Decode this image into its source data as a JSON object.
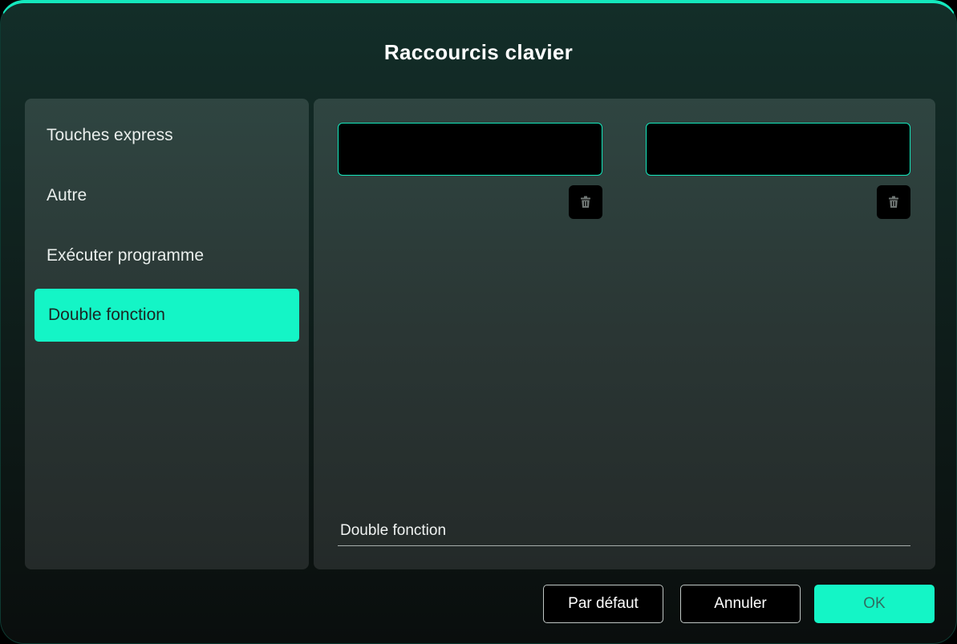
{
  "dialog": {
    "title": "Raccourcis clavier"
  },
  "sidebar": {
    "items": [
      {
        "label": "Touches express",
        "active": false
      },
      {
        "label": "Autre",
        "active": false
      },
      {
        "label": "Exécuter programme",
        "active": false
      },
      {
        "label": "Double fonction",
        "active": true
      }
    ]
  },
  "main": {
    "key_fields": [
      {
        "value": ""
      },
      {
        "value": ""
      }
    ],
    "mode_label": "Double fonction"
  },
  "footer": {
    "default_label": "Par défaut",
    "cancel_label": "Annuler",
    "ok_label": "OK"
  },
  "colors": {
    "accent": "#14f5c6",
    "background": "#0f1f1c",
    "panel": "#2a3634"
  },
  "icons": {
    "delete": "trash-icon"
  }
}
